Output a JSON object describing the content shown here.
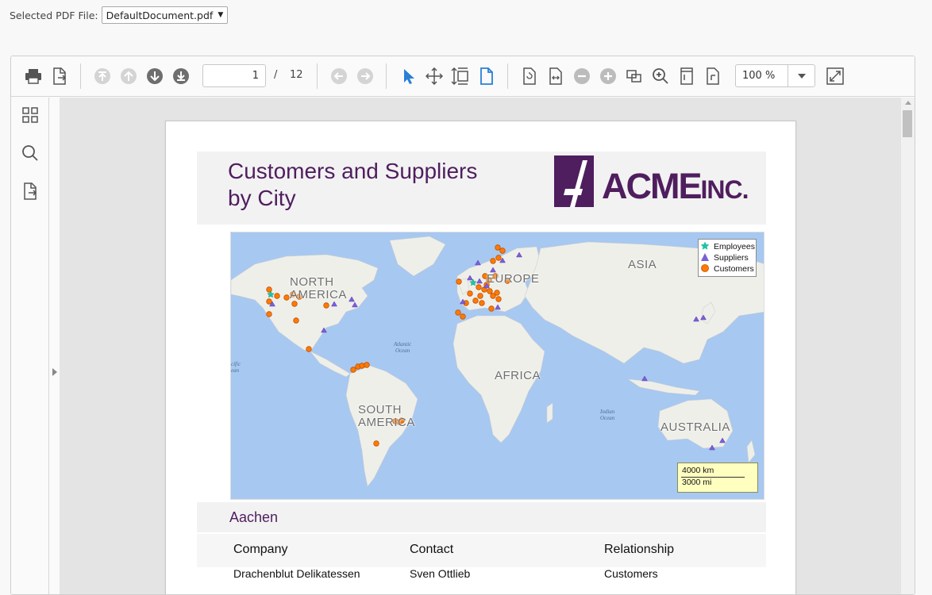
{
  "file_selector": {
    "label": "Selected PDF File:",
    "value": "DefaultDocument.pdf"
  },
  "toolbar": {
    "page_current": "1",
    "page_separator": "/",
    "page_total": "12",
    "zoom_value": "100 %",
    "icons": [
      "print-icon",
      "export-icon",
      "first-page-icon",
      "previous-page-icon",
      "next-page-icon",
      "last-page-icon",
      "back-icon",
      "forward-icon",
      "selection-tool-icon",
      "pan-tool-icon",
      "marquee-zoom-icon",
      "single-page-icon",
      "rotate-icon",
      "fit-page-icon",
      "zoom-out-icon",
      "zoom-in-icon",
      "fit-width-icon",
      "zoom-tool-icon",
      "continuous-scroll-icon",
      "page-scroll-icon",
      "fullscreen-icon"
    ]
  },
  "sidebar": {
    "icons": [
      "thumbnails-icon",
      "search-icon",
      "export-icon"
    ]
  },
  "document": {
    "title_line1": "Customers and Suppliers",
    "title_line2": "by City",
    "logo_text": "ACME",
    "logo_suffix": "INC.",
    "map": {
      "labels": {
        "north_america": [
          "NORTH",
          "AMERICA"
        ],
        "south_america": [
          "SOUTH",
          "AMERICA"
        ],
        "europe": "EUROPE",
        "asia": "ASIA",
        "africa": "AFRICA",
        "australia": "AUSTRALIA",
        "atlantic": [
          "Atlantic",
          "Ocean"
        ],
        "indian": [
          "Indian",
          "Ocean"
        ],
        "pacific": [
          "cific",
          "ean"
        ]
      },
      "legend": [
        {
          "label": "Employees",
          "shape": "star",
          "color": "#21c3a4"
        },
        {
          "label": "Suppliers",
          "shape": "triangle",
          "color": "#7b5fd6"
        },
        {
          "label": "Customers",
          "shape": "circle",
          "color": "#ff7a00"
        }
      ],
      "scale": {
        "km": "4000 km",
        "mi": "3000 mi"
      }
    },
    "city": "Aachen",
    "columns": [
      "Company",
      "Contact",
      "Relationship"
    ],
    "rows": [
      {
        "company": "Drachenblut Delikatessen",
        "contact": "Sven Ottlieb",
        "relationship": "Customers"
      }
    ]
  },
  "colors": {
    "brand": "#4f1e5e",
    "customer": "#ff7a00",
    "supplier": "#7b5fd6",
    "employee": "#21c3a4",
    "accent": "#2a7fd4"
  }
}
